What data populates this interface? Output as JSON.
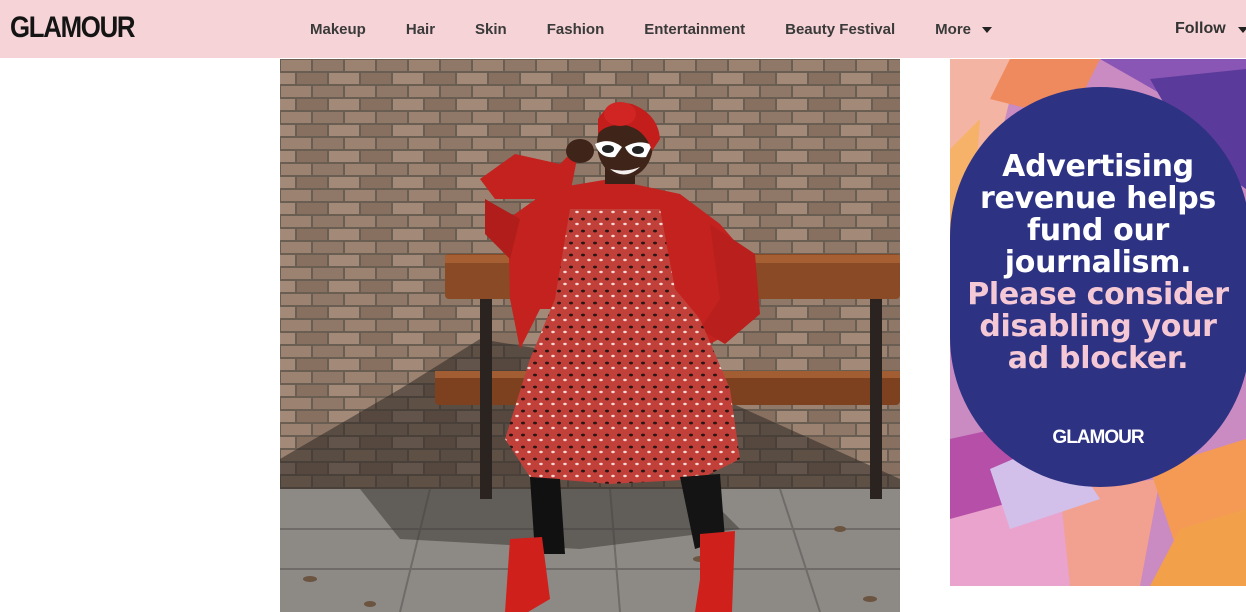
{
  "header": {
    "logo": "GLAMOUR",
    "nav": [
      {
        "label": "Makeup"
      },
      {
        "label": "Hair"
      },
      {
        "label": "Skin"
      },
      {
        "label": "Fashion"
      },
      {
        "label": "Entertainment"
      },
      {
        "label": "Beauty Festival"
      }
    ],
    "more_label": "More",
    "follow_label": "Follow"
  },
  "ad": {
    "lines_white": [
      "Advertising",
      "revenue helps",
      "fund our",
      "journalism."
    ],
    "lines_pink": [
      "Please consider",
      "disabling your",
      "ad blocker."
    ],
    "logo": "GLAMOUR"
  },
  "colors": {
    "header_bg": "#f6d3d6",
    "ad_circle": "#2d3283",
    "ad_pink_text": "#f4c8d4"
  }
}
